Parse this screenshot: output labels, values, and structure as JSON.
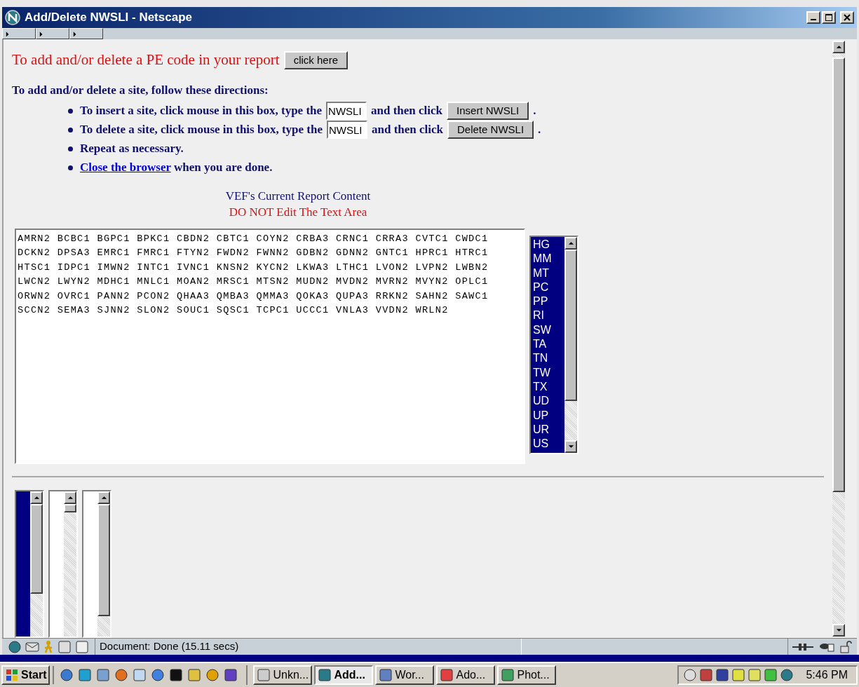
{
  "window": {
    "title": "Add/Delete NWSLI - Netscape"
  },
  "pe_section": {
    "text": "To add and/or delete a PE code in your report",
    "button": "click here"
  },
  "directions": {
    "heading": "To add and/or delete a site, follow these directions:",
    "items": [
      {
        "kind": "field",
        "text": "To insert a site, click mouse in this box, type the",
        "field_value": "NWSLI",
        "then": "and then click",
        "button": "Insert NWSLI",
        "end": "."
      },
      {
        "kind": "field",
        "text": "To delete a site, click mouse in this box, type the",
        "field_value": "NWSLI",
        "then": "and then click",
        "button": "Delete NWSLI",
        "end": "."
      },
      {
        "kind": "text",
        "text": "Repeat as necessary."
      },
      {
        "kind": "link",
        "link": "Close the browser",
        "text": "when you are done."
      }
    ]
  },
  "report": {
    "title": "VEF's Current Report Content",
    "warning": "DO NOT Edit The Text Area",
    "lines": [
      "AMRN2 BCBC1 BGPC1 BPKC1 CBDN2 CBTC1 COYN2 CRBA3 CRNC1 CRRA3 CVTC1 CWDC1",
      "DCKN2 DPSA3 EMRC1 FMRC1 FTYN2 FWDN2 FWNN2 GDBN2 GDNN2 GNTC1 HPRC1 HTRC1",
      "HTSC1 IDPC1 IMWN2 INTC1 IVNC1 KNSN2 KYCN2 LKWA3 LTHC1 LVON2 LVPN2 LWBN2",
      "LWCN2 LWYN2 MDHC1 MNLC1 MOAN2 MRSC1 MTSN2 MUDN2 MVDN2 MVRN2 MVYN2 OPLC1",
      "ORWN2 OVRC1 PANN2 PCON2 QHAA3 QMBA3 QMMA3 QOKA3 QUPA3 RRKN2 SAHN2 SAWC1",
      "SCCN2 SEMA3 SJNN2 SLON2 SOUC1 SQSC1 TCPC1 UCCC1 VNLA3 VVDN2 WRLN2"
    ],
    "pe_list": [
      {
        "label": "HG",
        "selected": true
      },
      {
        "label": "MM",
        "selected": true
      },
      {
        "label": "MT",
        "selected": true
      },
      {
        "label": "PC",
        "selected": true
      },
      {
        "label": "PP",
        "selected": true
      },
      {
        "label": "RI",
        "selected": true
      },
      {
        "label": "SW",
        "selected": true
      },
      {
        "label": "TA",
        "selected": true
      },
      {
        "label": "TN",
        "selected": true
      },
      {
        "label": "TW",
        "selected": true
      },
      {
        "label": "TX",
        "selected": true
      },
      {
        "label": "UD",
        "selected": true
      },
      {
        "label": "UP",
        "selected": true
      },
      {
        "label": "UR",
        "selected": true
      },
      {
        "label": "US",
        "selected": true
      }
    ]
  },
  "status_bar": {
    "text": "Document: Done (15.11 secs)"
  },
  "taskbar": {
    "start": "Start",
    "tasks": [
      {
        "label": "Unkn...",
        "selected": false
      },
      {
        "label": "Add...",
        "selected": true
      },
      {
        "label": "Wor...",
        "selected": false
      },
      {
        "label": "Ado...",
        "selected": false
      },
      {
        "label": "Phot...",
        "selected": false
      }
    ],
    "clock": "5:46 PM"
  }
}
